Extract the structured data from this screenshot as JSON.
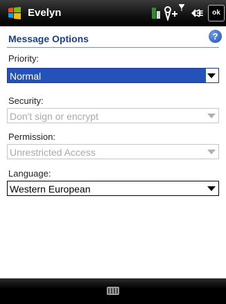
{
  "titlebar": {
    "title": "Evelyn",
    "ok_label": "ok"
  },
  "header": {
    "title": "Message Options"
  },
  "fields": [
    {
      "label": "Priority:",
      "value": "Normal",
      "state": "focused"
    },
    {
      "label": "Security:",
      "value": "Don't sign or encrypt",
      "state": "disabled"
    },
    {
      "label": "Permission:",
      "value": "Unrestricted Access",
      "state": "disabled"
    },
    {
      "label": "Language:",
      "value": "Western European",
      "state": "enabled"
    }
  ],
  "colors": {
    "header_title": "#1b3f8c",
    "selection": "#2552b8"
  },
  "icons": {
    "start": "windows-flag-icon",
    "sync": "sync-battery-icon",
    "signal": "signal-icon",
    "volume": "volume-icon",
    "help": "help-icon",
    "keyboard": "keyboard-icon"
  }
}
